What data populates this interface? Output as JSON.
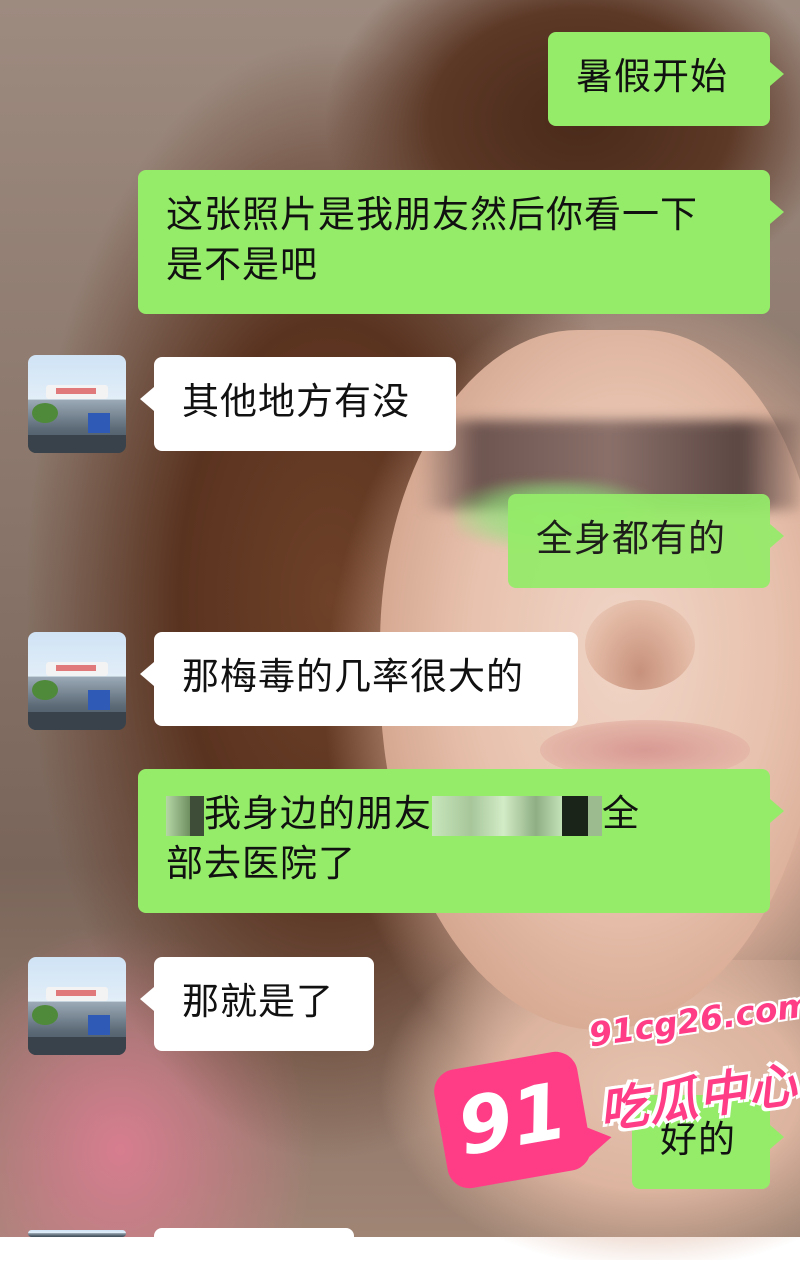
{
  "messages": [
    {
      "side": "right",
      "text": "暑假开始"
    },
    {
      "side": "right",
      "text": "这张照片是我朋友然后你看一下",
      "line2": "是不是吧"
    },
    {
      "side": "left",
      "text": "其他地方有没"
    },
    {
      "side": "right",
      "text": "全身都有的"
    },
    {
      "side": "left",
      "text": "那梅毒的几率很大的"
    },
    {
      "side": "right",
      "text_a": "我身边的朋友",
      "text_b": "全",
      "line2": "部去医院了"
    },
    {
      "side": "left",
      "text": "那就是了"
    },
    {
      "side": "right",
      "text": "好的"
    }
  ],
  "watermark": {
    "url": "91cg26.com",
    "logo_number": "91",
    "name": "吃瓜中心"
  },
  "colors": {
    "bubble_sent": "#95ec69",
    "bubble_received": "#ffffff",
    "watermark_pink": "#ff3d86"
  }
}
